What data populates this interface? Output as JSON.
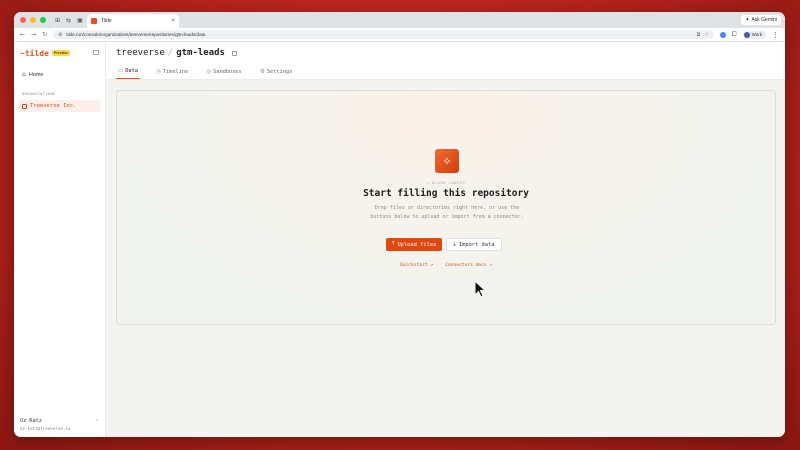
{
  "browser": {
    "tab_title": "Tilde",
    "tab_close": "×",
    "url": "tilde.run/console/organizations/treeverse/repositories/gtm-leads/data",
    "gemini_label": "Ask Gemini",
    "profile_label": "Work",
    "strip_icons": [
      "⊞",
      "⇆",
      "▣"
    ],
    "nav": {
      "back": "←",
      "forward": "→",
      "reload": "↻"
    }
  },
  "sidebar": {
    "brand": "~tilde",
    "badge": "Preview",
    "home_label": "Home",
    "org_section": "ORGANIZATIONS",
    "org_name": "Treeverse Inc.",
    "user_name": "Oz Katz",
    "user_email": "oz.katz@treeverse.io",
    "user_toggle": "⌃"
  },
  "header": {
    "org": "treeverse",
    "separator": "/",
    "repo": "gtm-leads",
    "tabs": [
      {
        "label": "Data",
        "icon": "▭"
      },
      {
        "label": "Timeline",
        "icon": "◷"
      },
      {
        "label": "Sandboxes",
        "icon": "◎"
      },
      {
        "label": "Settings",
        "icon": "⚙"
      }
    ]
  },
  "empty_state": {
    "eyebrow": "— BLANK CANVAS",
    "headline": "Start filling this repository",
    "description": "Drop files or directories right here, or use the buttons below to upload or import from a connector.",
    "upload_label": "Upload files",
    "import_label": "Import data",
    "quickstart_label": "Quickstart ↗",
    "connectors_label": "Connectors docs ↗"
  },
  "colors": {
    "accent": "#e0480f",
    "desktop": "#c22b21"
  }
}
